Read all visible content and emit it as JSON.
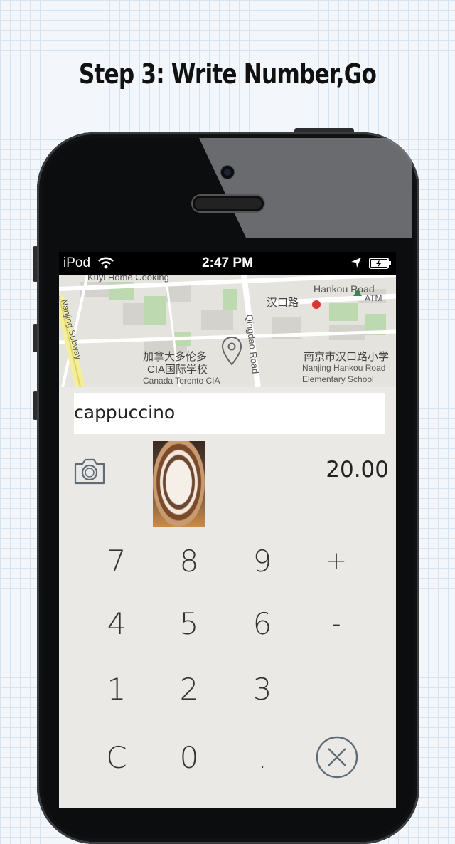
{
  "headline": "Step 3: Write Number,Go",
  "status": {
    "carrier": "iPod",
    "time": "2:47 PM"
  },
  "map": {
    "labels": [
      "Kuyi Home Cooking",
      "Hankou Road",
      "汉口路",
      "ATM",
      "Qingdao Road",
      "加拿大多伦多",
      "CIA国际学校",
      "Canada Toronto CIA",
      "南京市汉口路小学",
      "Nanjing Hankou Road",
      "Elementary School",
      "Nanjing Subway"
    ]
  },
  "item": {
    "name": "cappuccino",
    "amount": "20.00"
  },
  "keypad": {
    "rows": [
      [
        "7",
        "8",
        "9",
        "+"
      ],
      [
        "4",
        "5",
        "6",
        "-"
      ],
      [
        "1",
        "2",
        "3"
      ],
      [
        "C",
        "0",
        "."
      ]
    ]
  },
  "icons": {
    "camera": "camera-icon",
    "clear": "clear-circle-x-icon",
    "pin": "map-pin-icon"
  }
}
